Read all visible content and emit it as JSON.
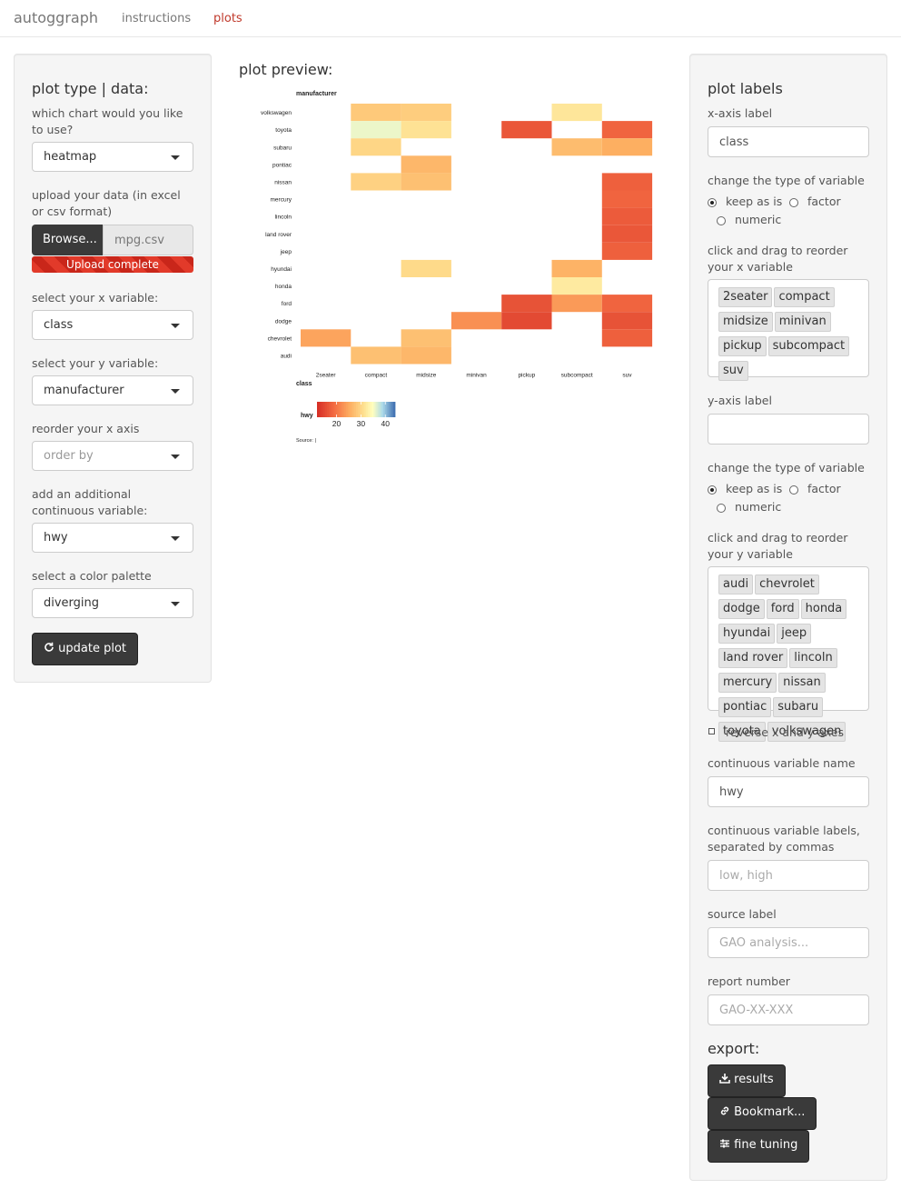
{
  "nav": {
    "brand": "autoggraph",
    "links": [
      {
        "label": "instructions",
        "active": false
      },
      {
        "label": "plots",
        "active": true
      }
    ]
  },
  "left": {
    "title": "plot type | data:",
    "chart_type_label": "which chart would you like to use?",
    "chart_type_value": "heatmap",
    "upload_label": "upload your data (in excel or csv format)",
    "browse_label": "Browse...",
    "file_name": "mpg.csv",
    "upload_status": "Upload complete",
    "x_label": "select your x variable:",
    "x_value": "class",
    "y_label": "select your y variable:",
    "y_value": "manufacturer",
    "reorder_label": "reorder your x axis",
    "reorder_placeholder": "order by",
    "continuous_label": "add an additional continuous variable:",
    "continuous_value": "hwy",
    "palette_label": "select a color palette",
    "palette_value": "diverging",
    "update_button": "update plot"
  },
  "preview": {
    "title": "plot preview:"
  },
  "right": {
    "title": "plot labels",
    "x_axis_label": "x-axis label",
    "x_axis_value": "class",
    "change_type_label": "change the type of variable",
    "radio_keep": "keep as is",
    "radio_factor": "factor",
    "radio_numeric": "numeric",
    "reorder_x_label": "click and drag to reorder your x variable",
    "x_order": [
      "2seater",
      "compact",
      "midsize",
      "minivan",
      "pickup",
      "subcompact",
      "suv"
    ],
    "y_axis_label": "y-axis label",
    "y_axis_value": "",
    "reorder_y_label": "click and drag to reorder your y variable",
    "y_order": [
      "audi",
      "chevrolet",
      "dodge",
      "ford",
      "honda",
      "hyundai",
      "jeep",
      "land rover",
      "lincoln",
      "mercury",
      "nissan",
      "pontiac",
      "subaru",
      "toyota",
      "volkswagen"
    ],
    "reverse_label": "reverse x and y axes",
    "cont_name_label": "continuous variable name",
    "cont_name_value": "hwy",
    "cont_labels_label": "continuous variable labels, separated by commas",
    "cont_labels_placeholder": "low, high",
    "source_label": "source label",
    "source_placeholder": "GAO analysis...",
    "report_label": "report number",
    "report_placeholder": "GAO-XX-XXX",
    "export_title": "export:",
    "btn_results": "results",
    "btn_bookmark": "Bookmark...",
    "btn_fine": "fine tuning"
  },
  "chart_data": {
    "type": "heatmap",
    "title": "",
    "xlabel": "class",
    "ylabel": "manufacturer",
    "x": [
      "2seater",
      "compact",
      "midsize",
      "minivan",
      "pickup",
      "subcompact",
      "suv"
    ],
    "y": [
      "volkswagen",
      "toyota",
      "subaru",
      "pontiac",
      "nissan",
      "mercury",
      "lincoln",
      "land rover",
      "jeep",
      "hyundai",
      "honda",
      "ford",
      "dodge",
      "chevrolet",
      "audi"
    ],
    "values": [
      [
        null,
        28.5,
        29,
        null,
        null,
        32,
        null
      ],
      [
        null,
        36,
        31.5,
        null,
        16.5,
        null,
        18
      ],
      [
        null,
        30,
        null,
        null,
        null,
        27,
        25.5
      ],
      [
        null,
        null,
        26.5,
        null,
        null,
        null,
        null
      ],
      [
        null,
        29.5,
        27.5,
        null,
        null,
        null,
        17.5
      ],
      [
        null,
        null,
        null,
        null,
        null,
        null,
        18
      ],
      [
        null,
        null,
        null,
        null,
        null,
        null,
        17
      ],
      [
        null,
        null,
        null,
        null,
        null,
        null,
        16.5
      ],
      [
        null,
        null,
        null,
        null,
        null,
        null,
        17.5
      ],
      [
        null,
        null,
        30.5,
        null,
        null,
        26,
        null
      ],
      [
        null,
        null,
        null,
        null,
        null,
        32.5,
        null
      ],
      [
        null,
        null,
        null,
        null,
        16,
        23.5,
        18
      ],
      [
        null,
        null,
        null,
        22.5,
        15,
        null,
        16
      ],
      [
        24.5,
        null,
        27.5,
        null,
        null,
        null,
        17.5
      ],
      [
        null,
        27.5,
        26.5,
        null,
        null,
        null,
        null
      ]
    ],
    "legend": {
      "title": "hwy",
      "ticks": [
        20,
        30,
        40
      ],
      "range": [
        12,
        44
      ]
    },
    "source": "Source: |"
  }
}
